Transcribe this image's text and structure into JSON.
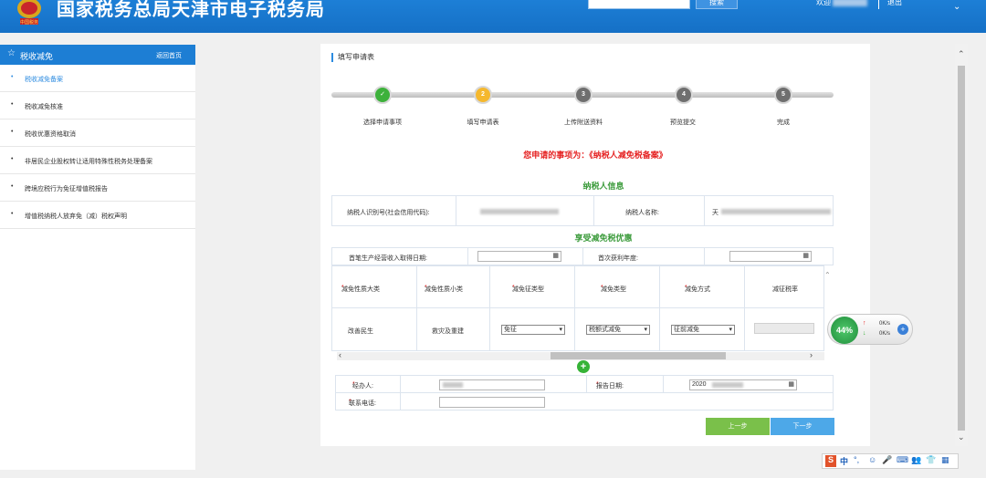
{
  "header": {
    "site_title": "国家税务总局天津市电子税务局",
    "search_button": "搜索",
    "login_prefix": "欢迎",
    "logout": "退出"
  },
  "sidebar": {
    "title": "税收减免",
    "back_home": "返回首页",
    "items": [
      {
        "label": "税收减免备案",
        "active": true
      },
      {
        "label": "税收减免核准"
      },
      {
        "label": "税收优惠资格取消"
      },
      {
        "label": "非居民企业股权转让适用特殊性税务处理备案"
      },
      {
        "label": "跨境应税行为免征增值税报告"
      },
      {
        "label": "增值税纳税人放弃免（减）税权声明"
      }
    ]
  },
  "main": {
    "panel_title": "填写申请表",
    "steps": [
      {
        "num": "✓",
        "label": "选择申请事项",
        "state": "done"
      },
      {
        "num": "2",
        "label": "填写申请表",
        "state": "current"
      },
      {
        "num": "3",
        "label": "上传附送资料",
        "state": "todo"
      },
      {
        "num": "4",
        "label": "预览提交",
        "state": "todo"
      },
      {
        "num": "5",
        "label": "完成",
        "state": "todo"
      }
    ],
    "apply_item_text": "您申请的事项为：《纳税人减免税备案》",
    "taxpayer_section": "纳税人信息",
    "taxpayer_id_label": "纳税人识别号(社会信用代码):",
    "taxpayer_name_label": "纳税人名称:",
    "taxpayer_name_prefix": "天",
    "preferential_section": "享受减免税优惠",
    "first_income_date_label": "首笔生产经营收入取得日期:",
    "first_profit_year_label": "首次获利年度:",
    "table": {
      "headers": [
        "减免性质大类",
        "减免性质小类",
        "减免征类型",
        "减免类型",
        "减免方式",
        "减征税率"
      ],
      "required": [
        true,
        true,
        true,
        true,
        true,
        false
      ],
      "row": {
        "big_category": "改善民生",
        "small_category": "救灾及重建",
        "exemption_type": "免征",
        "reduction_type": "税额式减免",
        "reduction_method": "征前减免"
      }
    },
    "agent_label": "经办人:",
    "report_date_label": "报告日期:",
    "report_date_prefix": "2020",
    "phone_label": "联系电话:",
    "prev_button": "上一步",
    "next_button": "下一步"
  },
  "widget": {
    "percent": "44%",
    "up_speed": "0K/s",
    "down_speed": "0K/s"
  },
  "ime": {
    "items": [
      "S",
      "中",
      "°,",
      "☺",
      "🎤",
      "⌨",
      "👥",
      "👕",
      "▦"
    ]
  },
  "colors": {
    "header_blue": "#1d7fd6",
    "done_green": "#3db13b",
    "current_yellow": "#f5b82e",
    "todo_gray": "#6f6f6f",
    "accent_red": "#e52222",
    "section_green": "#3b9b3b"
  }
}
